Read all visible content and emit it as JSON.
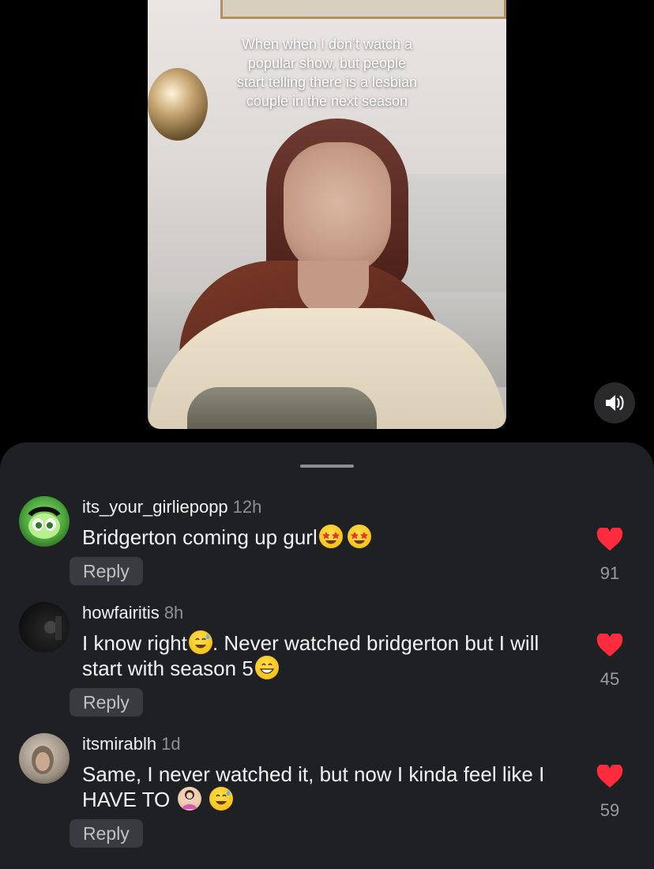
{
  "video": {
    "caption_lines": [
      "When when I don’t watch a",
      "popular show, but people",
      "start telling there is a lesbian",
      "couple in the next season"
    ],
    "sound_icon": "speaker-volume-icon"
  },
  "comments_sheet": {
    "comments": [
      {
        "username": "its_your_girliepopp",
        "time": "12h",
        "text_parts": [
          "Bridgerton coming up gurl"
        ],
        "reply_label": "Reply",
        "likes": "91"
      },
      {
        "username": "howfairitis",
        "time": "8h",
        "text_parts": [
          "I know right",
          ". Never watched bridgerton but I will start with season 5"
        ],
        "reply_label": "Reply",
        "likes": "45"
      },
      {
        "username": "itsmirablh",
        "time": "1d",
        "text_parts": [
          "Same, I never watched it, but now I kinda feel like I HAVE TO "
        ],
        "reply_label": "Reply",
        "likes": "59"
      }
    ]
  },
  "colors": {
    "background": "#000000",
    "sheet": "#1f2024",
    "heart": "#fe2c3d",
    "reply_pill": "#3a3b40"
  }
}
